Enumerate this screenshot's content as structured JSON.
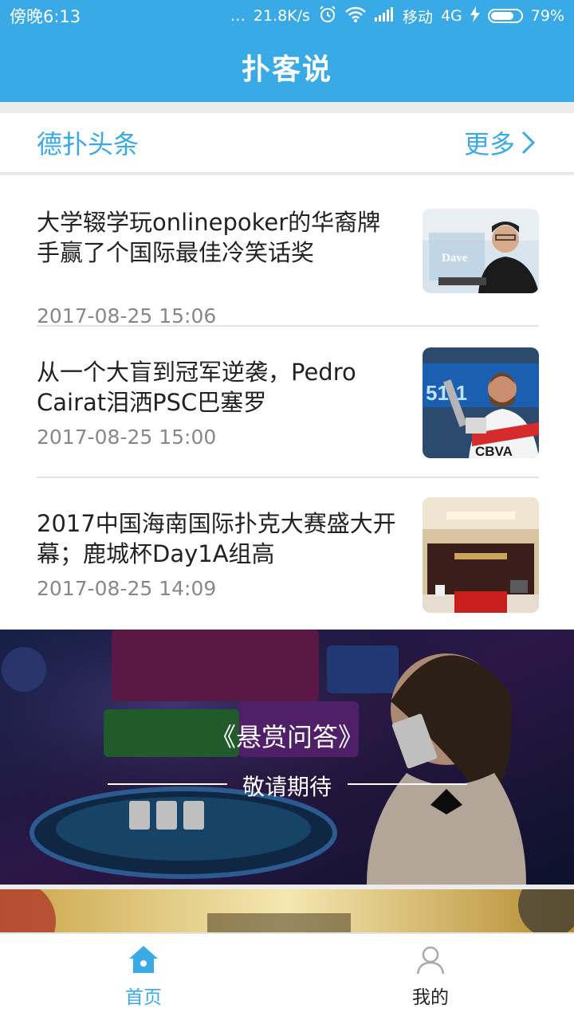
{
  "status_bar": {
    "time": "傍晚6:13",
    "dots": "…",
    "speed": "21.8K/s",
    "carrier": "移动",
    "network": "4G",
    "battery": "79%",
    "battery_level": 0.79
  },
  "header": {
    "title": "扑客说"
  },
  "section": {
    "title": "德扑头条",
    "more_label": "更多"
  },
  "news": [
    {
      "title": "大学辍学玩onlinepoker的华裔牌手赢了个国际最佳冷笑话奖",
      "time": "2017-08-25 15:06",
      "thumb_text": "Dave"
    },
    {
      "title": "从一个大盲到冠军逆袭，Pedro Cairat泪洒PSC巴塞罗",
      "time": "2017-08-25 15:00",
      "thumb_text": "CBVA"
    },
    {
      "title": "2017中国海南国际扑克大赛盛大开幕；鹿城杯Day1A组高",
      "time": "2017-08-25 14:09",
      "thumb_text": ""
    }
  ],
  "banner": {
    "title": "《悬赏问答》",
    "subtitle": "敬请期待"
  },
  "tabs": [
    {
      "label": "首页",
      "color": "#3aaae6"
    },
    {
      "label": "我的",
      "color": "#222222"
    }
  ],
  "colors": {
    "accent": "#3aaae6",
    "text": "#222222",
    "muted": "#888888"
  }
}
